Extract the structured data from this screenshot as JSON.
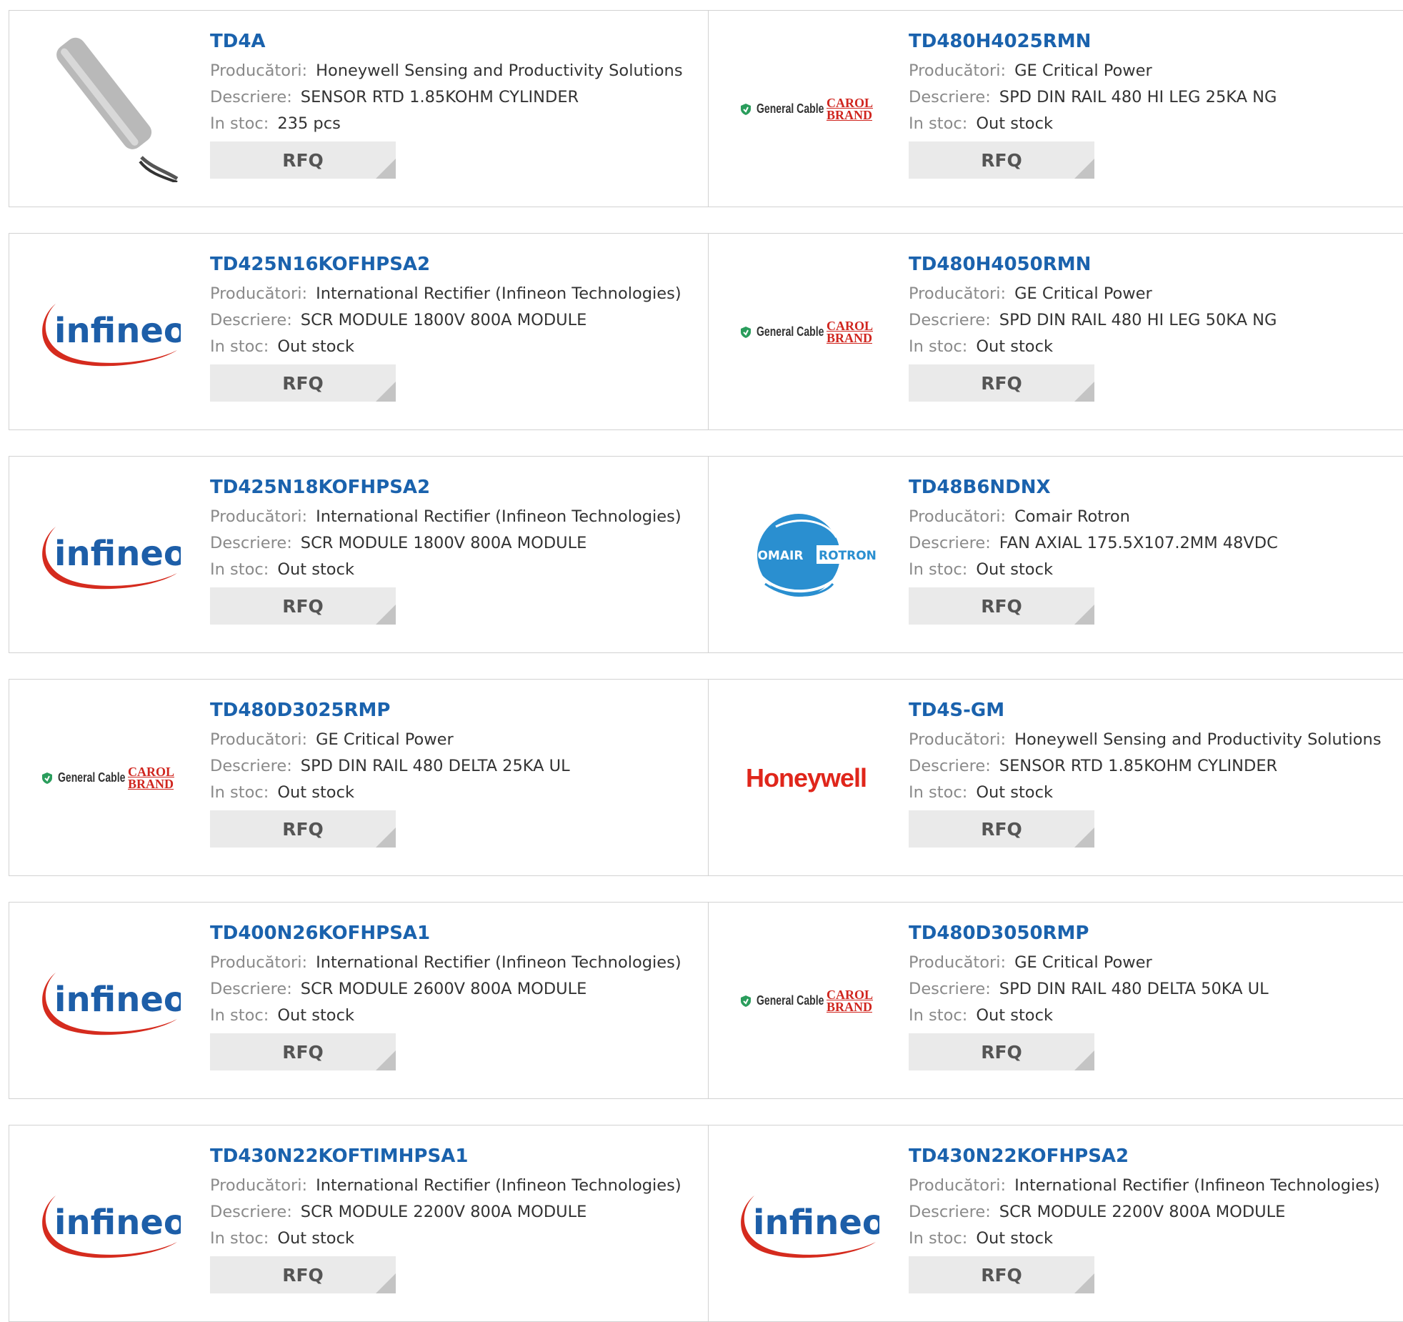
{
  "labels": {
    "manufacturer": "Producători:",
    "description": "Descriere:",
    "stock": "In stoc:",
    "rfq": "RFQ"
  },
  "products": [
    {
      "part": "TD4A",
      "manufacturer": "Honeywell Sensing and Productivity Solutions",
      "description": "SENSOR RTD 1.85KOHM CYLINDER",
      "stock": "235 pcs",
      "image": "sensor-photo"
    },
    {
      "part": "TD480H4025RMN",
      "manufacturer": "GE Critical Power",
      "description": "SPD DIN RAIL 480 HI LEG 25KA NG",
      "stock": "Out stock",
      "image": "general-cable-logo"
    },
    {
      "part": "TD425N16KOFHPSA2",
      "manufacturer": "International Rectifier (Infineon Technologies)",
      "description": "SCR MODULE 1800V 800A MODULE",
      "stock": "Out stock",
      "image": "infineon-logo"
    },
    {
      "part": "TD480H4050RMN",
      "manufacturer": "GE Critical Power",
      "description": "SPD DIN RAIL 480 HI LEG 50KA NG",
      "stock": "Out stock",
      "image": "general-cable-logo"
    },
    {
      "part": "TD425N18KOFHPSA2",
      "manufacturer": "International Rectifier (Infineon Technologies)",
      "description": "SCR MODULE 1800V 800A MODULE",
      "stock": "Out stock",
      "image": "infineon-logo"
    },
    {
      "part": "TD48B6NDNX",
      "manufacturer": "Comair Rotron",
      "description": "FAN AXIAL 175.5X107.2MM 48VDC",
      "stock": "Out stock",
      "image": "comair-rotron-logo"
    },
    {
      "part": "TD480D3025RMP",
      "manufacturer": "GE Critical Power",
      "description": "SPD DIN RAIL 480 DELTA 25KA UL",
      "stock": "Out stock",
      "image": "general-cable-logo"
    },
    {
      "part": "TD4S-GM",
      "manufacturer": "Honeywell Sensing and Productivity Solutions",
      "description": "SENSOR RTD 1.85KOHM CYLINDER",
      "stock": "Out stock",
      "image": "honeywell-logo"
    },
    {
      "part": "TD400N26KOFHPSA1",
      "manufacturer": "International Rectifier (Infineon Technologies)",
      "description": "SCR MODULE 2600V 800A MODULE",
      "stock": "Out stock",
      "image": "infineon-logo"
    },
    {
      "part": "TD480D3050RMP",
      "manufacturer": "GE Critical Power",
      "description": "SPD DIN RAIL 480 DELTA 50KA UL",
      "stock": "Out stock",
      "image": "general-cable-logo"
    },
    {
      "part": "TD430N22KOFTIMHPSA1",
      "manufacturer": "International Rectifier (Infineon Technologies)",
      "description": "SCR MODULE 2200V 800A MODULE",
      "stock": "Out stock",
      "image": "infineon-logo"
    },
    {
      "part": "TD430N22KOFHPSA2",
      "manufacturer": "International Rectifier (Infineon Technologies)",
      "description": "SCR MODULE 2200V 800A MODULE",
      "stock": "Out stock",
      "image": "infineon-logo"
    }
  ],
  "logos": {
    "infineon": "infineon",
    "general_cable": "General Cable",
    "carol_top": "CAROL",
    "carol_bottom": "BRAND",
    "honeywell": "Honeywell",
    "comair": "COMAIR",
    "rotron": "ROTRON"
  },
  "colors": {
    "link": "#1a62ad",
    "border": "#d2d2d2",
    "rfq_bg": "#eaeaea",
    "infineon_red": "#d52b1e",
    "infineon_blue": "#1d5ea8",
    "honeywell_red": "#e0261b",
    "general_cable_green": "#2a9d5c",
    "comair_blue": "#2a8fd0"
  }
}
